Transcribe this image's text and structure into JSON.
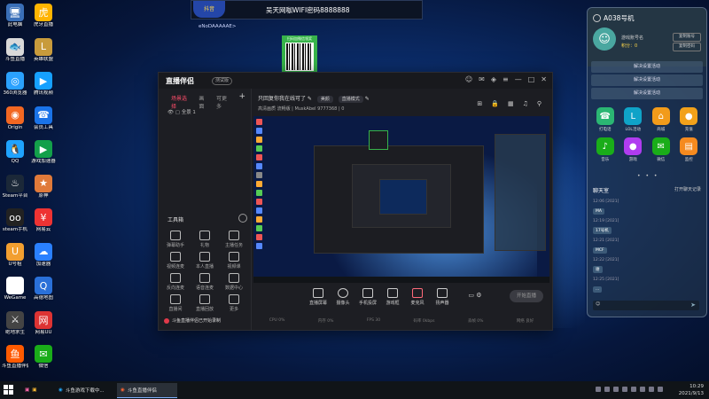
{
  "desktop_icons": [
    {
      "label": "此电脑",
      "color": "#3a6fb8",
      "glyph": "🖥"
    },
    {
      "label": "斗鱼直播",
      "color": "#d9d9d9",
      "glyph": "🐟"
    },
    {
      "label": "360浏览器",
      "color": "#2aa1ff",
      "glyph": "◎"
    },
    {
      "label": "Origin",
      "color": "#f26722",
      "glyph": "◉"
    },
    {
      "label": "QQ",
      "color": "#1fa3ff",
      "glyph": "🐧"
    },
    {
      "label": "Steam平台",
      "color": "#1b2838",
      "glyph": "♨"
    },
    {
      "label": "steam手机",
      "color": "#222",
      "glyph": "oo"
    },
    {
      "label": "U号租",
      "color": "#f29f30",
      "glyph": "U"
    },
    {
      "label": "WeGame",
      "color": "#fff",
      "glyph": "G"
    },
    {
      "label": "绝地求生",
      "color": "#444",
      "glyph": "⚔"
    },
    {
      "label": "斗鱼直播伴侣",
      "color": "#ff5a00",
      "glyph": "鱼"
    },
    {
      "label": "虎牙直播",
      "color": "#ffb400",
      "glyph": "虎"
    },
    {
      "label": "英雄联盟",
      "color": "#c89b3c",
      "glyph": "L"
    },
    {
      "label": "腾讯视频",
      "color": "#16a0ff",
      "glyph": "▶"
    },
    {
      "label": "会员工具",
      "color": "#1a73e8",
      "glyph": "☎"
    },
    {
      "label": "游戏加速器",
      "color": "#13a04a",
      "glyph": "▶"
    },
    {
      "label": "原神",
      "color": "#e07a3a",
      "glyph": "★"
    },
    {
      "label": "网易云",
      "color": "#e33",
      "glyph": "¥"
    },
    {
      "label": "加速器",
      "color": "#2a80ff",
      "glyph": "☁"
    },
    {
      "label": "高德地图",
      "color": "#2a70d8",
      "glyph": "Q"
    },
    {
      "label": "网易UU",
      "color": "#d33",
      "glyph": "网"
    },
    {
      "label": "微信",
      "color": "#1aad19",
      "glyph": "✉"
    }
  ],
  "banner": {
    "logo": "抖音",
    "text": "吴天网咖WIFI密码8888888",
    "sub": "eNoDAAAAAE>"
  },
  "qr_caption": "扫码加微信领奖",
  "window": {
    "app_name": "直播伴侣",
    "badge": "测试版",
    "left_tabs": [
      "场景选择",
      "画面",
      "可更多"
    ],
    "add_symbol": "+",
    "scene_label": "全景 1",
    "tools_title": "工具箱",
    "tools": [
      {
        "label": "弹幕助手"
      },
      {
        "label": "礼物"
      },
      {
        "label": "主播任务"
      },
      {
        "label": "视频连麦"
      },
      {
        "label": "本人直播"
      },
      {
        "label": "视频课"
      },
      {
        "label": "反向连麦"
      },
      {
        "label": "语音连麦"
      },
      {
        "label": "数据中心"
      },
      {
        "label": "直播间"
      },
      {
        "label": "直播回放"
      },
      {
        "label": "更多"
      }
    ],
    "warning": "斗鱼直播伴侣已开始录制",
    "title_line": "只回复你我在线可了",
    "chip1": "美颜",
    "chip2": "直播模式",
    "meta_line": "高清画质  流畅版  |  MuskAbel  9777368  |  0",
    "bottom_buttons": [
      {
        "label": "直播屏幕"
      },
      {
        "label": "摄像头"
      },
      {
        "label": "手机投屏"
      },
      {
        "label": "游戏框"
      },
      {
        "label": "麦克风"
      },
      {
        "label": "扬声器"
      }
    ],
    "start_button": "开始直播",
    "stats": [
      "CPU 0%",
      "内存 0%",
      "FPS 30",
      "码率 0kbps",
      "丢帧 0%",
      "网络 良好"
    ]
  },
  "phone": {
    "title": "A038号机",
    "line1": "游戏账号名",
    "line2": "积分：0",
    "btn1": "复制账号",
    "btn2": "复制密码",
    "actions": [
      "解决设置活动",
      "解决设置活动",
      "解决设置活动"
    ],
    "apps": [
      {
        "label": "打电话",
        "color": "#2bb673",
        "glyph": "☎"
      },
      {
        "label": "LOL活动",
        "color": "#0fa3c8",
        "glyph": "L"
      },
      {
        "label": "商城",
        "color": "#f29b1a",
        "glyph": "⌂"
      },
      {
        "label": "充值",
        "color": "#f2a11a",
        "glyph": "●"
      },
      {
        "label": "音乐",
        "color": "#1aad19",
        "glyph": "♪"
      },
      {
        "label": "游戏",
        "color": "#b03cf0",
        "glyph": "●"
      },
      {
        "label": "微信",
        "color": "#1aad19",
        "glyph": "✉"
      },
      {
        "label": "监控",
        "color": "#f58a1f",
        "glyph": "▤"
      }
    ],
    "dots": "• • •",
    "chat_title": "聊天室",
    "chat_link": "打开聊天记录",
    "messages": [
      {
        "time": "12:06 [2021]",
        "text": "MA"
      },
      {
        "time": "12:19 [2021]",
        "text": "17号机"
      },
      {
        "time": "12:21 [2021]",
        "text": "MCF"
      },
      {
        "time": "12:22 [2021]",
        "text": "谢"
      },
      {
        "time": "12:25 [2021]",
        "text": "..."
      }
    ],
    "input_placeholder": "☺",
    "send_icon": "➤"
  },
  "taskbar": {
    "items": [
      {
        "label": "斗鱼游戏下载中..."
      },
      {
        "label": "斗鱼直播伴侣"
      }
    ],
    "time": "10:29",
    "date": "2021/9/13"
  }
}
